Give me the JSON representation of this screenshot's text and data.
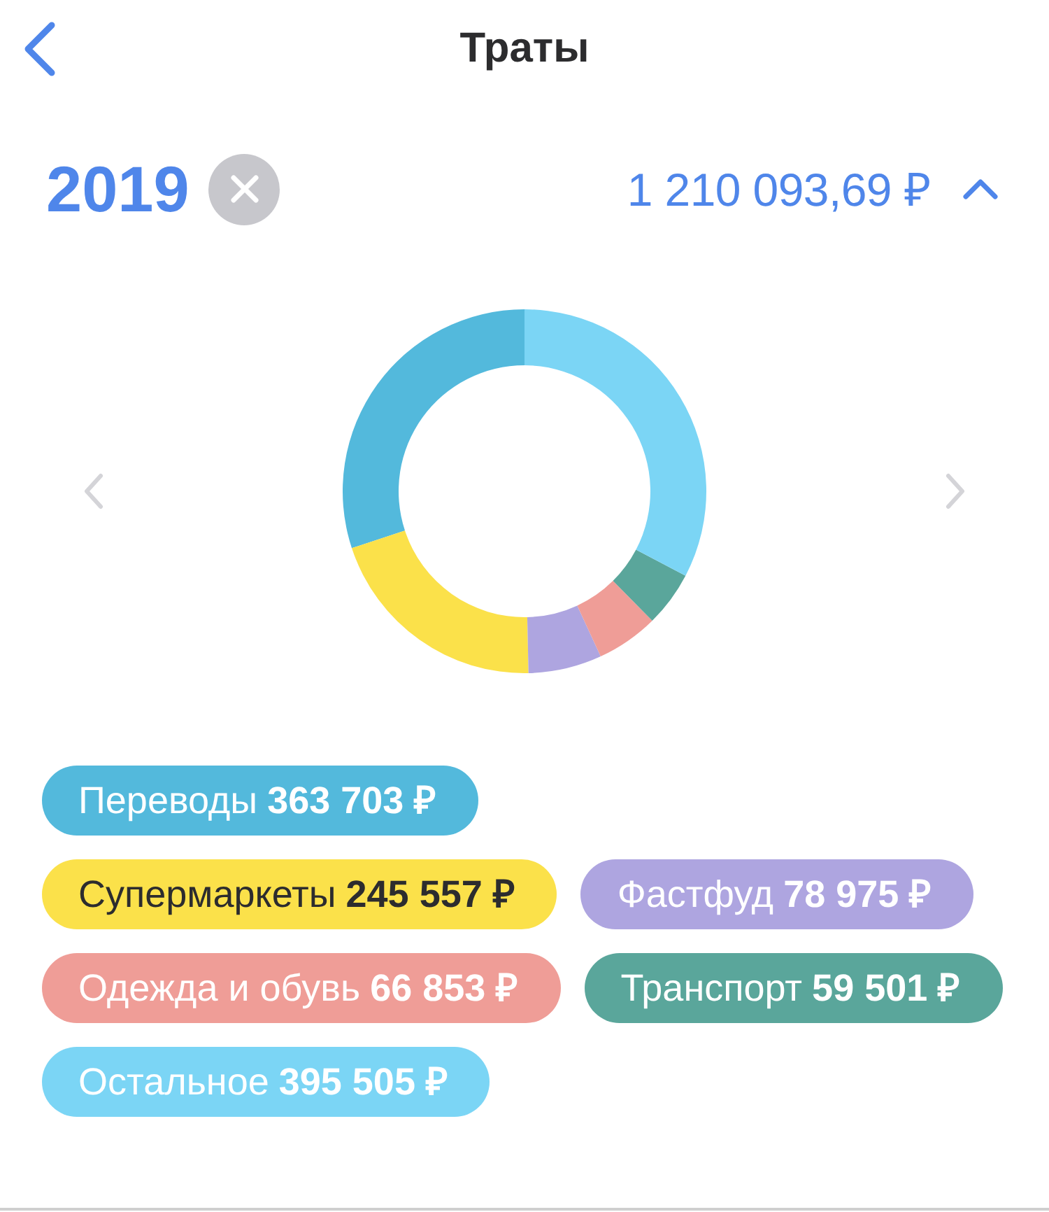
{
  "header": {
    "title": "Траты"
  },
  "period": {
    "year": "2019",
    "total": "1 210 093,69 ₽",
    "expanded": true
  },
  "chart": {
    "chart_data": {
      "type": "donut",
      "values": [
        30.06,
        20.29,
        6.53,
        5.52,
        4.92,
        32.68
      ]
    }
  },
  "legend": [
    {
      "label": "Переводы",
      "amount": "363 703 ₽",
      "color": "#53b9dc"
    },
    {
      "label": "Супермаркеты",
      "amount": "245 557 ₽",
      "color": "#fbe14a"
    },
    {
      "label": "Фастфуд",
      "amount": "78 975 ₽",
      "color": "#aea5e0"
    },
    {
      "label": "Одежда и обувь",
      "amount": "66 853 ₽",
      "color": "#ef9d97"
    },
    {
      "label": "Транспорт",
      "amount": "59 501 ₽",
      "color": "#5aa69b"
    },
    {
      "label": "Остальное",
      "amount": "395 505 ₽",
      "color": "#7bd5f5"
    }
  ]
}
